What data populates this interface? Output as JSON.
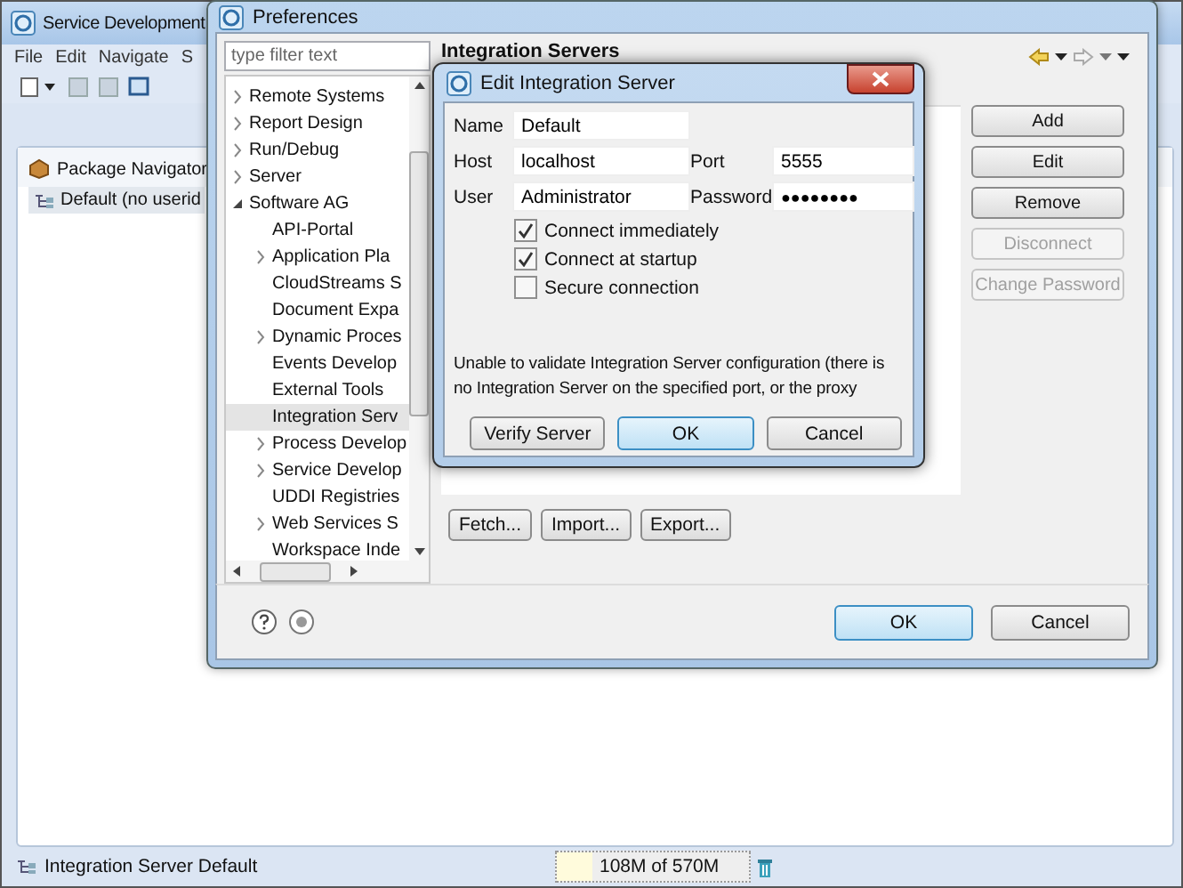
{
  "main_window": {
    "title": "Service Development",
    "menu": [
      "File",
      "Edit",
      "Navigate",
      "S"
    ],
    "view": {
      "title": "Package Navigator",
      "items": [
        {
          "label": "Default (no userid",
          "selected": true
        }
      ]
    },
    "status_bar": {
      "message": "Integration Server Default",
      "heap": "108M of 570M"
    }
  },
  "preferences": {
    "title": "Preferences",
    "filter": {
      "placeholder": "type filter text"
    },
    "tree": [
      {
        "label": "Remote Systems",
        "kind": "folder",
        "expanded": false,
        "selected": false
      },
      {
        "label": "Report Design",
        "kind": "folder",
        "expanded": false,
        "selected": false
      },
      {
        "label": "Run/Debug",
        "kind": "folder",
        "expanded": false,
        "selected": false
      },
      {
        "label": "Server",
        "kind": "folder",
        "expanded": false,
        "selected": false
      },
      {
        "label": "Software AG",
        "kind": "folder",
        "expanded": true,
        "selected": false,
        "children": [
          {
            "label": "API-Portal",
            "kind": "leaf",
            "selected": false
          },
          {
            "label": "Application Pla",
            "kind": "folder",
            "expanded": false,
            "selected": false
          },
          {
            "label": "CloudStreams S",
            "kind": "leaf",
            "selected": false
          },
          {
            "label": "Document Expa",
            "kind": "leaf",
            "selected": false
          },
          {
            "label": "Dynamic Proces",
            "kind": "folder",
            "expanded": false,
            "selected": false
          },
          {
            "label": "Events Develop",
            "kind": "leaf",
            "selected": false
          },
          {
            "label": "External Tools",
            "kind": "leaf",
            "selected": false
          },
          {
            "label": "Integration Serv",
            "kind": "leaf",
            "selected": true
          },
          {
            "label": "Process Develop",
            "kind": "folder",
            "expanded": false,
            "selected": false
          },
          {
            "label": "Service Develop",
            "kind": "folder",
            "expanded": false,
            "selected": false
          },
          {
            "label": "UDDI Registries",
            "kind": "leaf",
            "selected": false
          },
          {
            "label": "Web Services S",
            "kind": "folder",
            "expanded": false,
            "selected": false
          },
          {
            "label": "Workspace Inde",
            "kind": "leaf",
            "selected": false
          }
        ]
      }
    ],
    "page": {
      "title": "Integration Servers",
      "side_buttons": [
        {
          "label": "Add",
          "disabled": false
        },
        {
          "label": "Edit",
          "disabled": false
        },
        {
          "label": "Remove",
          "disabled": false
        },
        {
          "label": "Disconnect",
          "disabled": true
        },
        {
          "label": "Change Password",
          "disabled": true
        }
      ],
      "bottom_buttons": [
        "Fetch...",
        "Import...",
        "Export..."
      ]
    },
    "buttons": [
      {
        "label": "OK",
        "default": true
      },
      {
        "label": "Cancel",
        "default": false
      }
    ]
  },
  "dialog": {
    "title": "Edit Integration Server",
    "fields": {
      "name": {
        "label": "Name",
        "value": "Default"
      },
      "host": {
        "label": "Host",
        "value": "localhost"
      },
      "port": {
        "label": "Port",
        "value": "5555"
      },
      "user": {
        "label": "User",
        "value": "Administrator"
      },
      "password": {
        "label": "Password",
        "value": "●●●●●●●●"
      }
    },
    "options": [
      {
        "label": "Connect immediately",
        "checked": true
      },
      {
        "label": "Connect at startup",
        "checked": true
      },
      {
        "label": "Secure connection",
        "checked": false
      }
    ],
    "message": "Unable to validate Integration Server configuration (there is no Integration Server on the specified port, or the proxy",
    "buttons": [
      {
        "label": "Verify Server",
        "default": false
      },
      {
        "label": "OK",
        "default": true
      },
      {
        "label": "Cancel",
        "default": false
      }
    ]
  }
}
